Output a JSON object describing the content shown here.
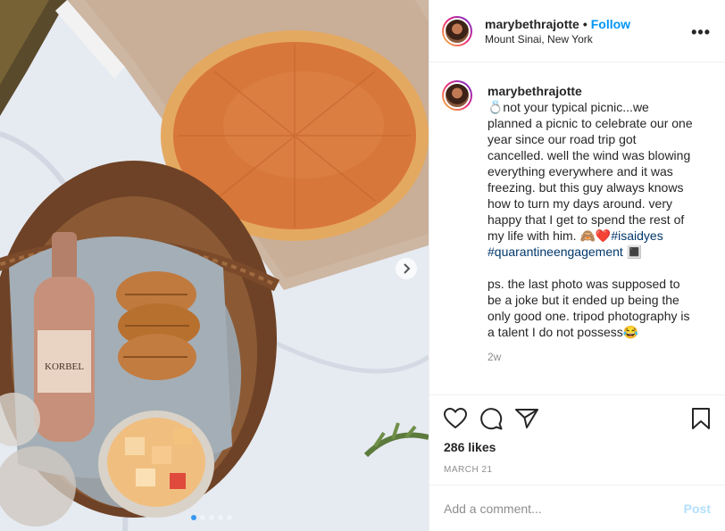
{
  "post": {
    "username": "marybethrajotte",
    "follow_label": "Follow",
    "separator": "•",
    "location": "Mount Sinai, New York",
    "more_label": "•••",
    "caption_lines": [
      "💍not your typical picnic...we",
      "planned a picnic to celebrate our one",
      "year since our road trip got",
      "cancelled. well the wind was blowing",
      "everything everywhere and it was",
      "freezing. but this guy always knows",
      "how to turn my days around. very",
      "happy that I get to spend the rest of",
      "my life with him. 🙈❤️"
    ],
    "hashtag1": "#isaidyes",
    "hashtag2": "#quarantineengagement",
    "hashtag2_suffix": " 🔳",
    "caption_ps_lines": [
      "ps. the last photo was supposed to",
      "be a joke but it ended up being the",
      "only good one. tripod photography is",
      "a talent I do not possess😂"
    ],
    "time_ago": "2w",
    "likes": "286 likes",
    "date": "MARCH 21",
    "comment_placeholder": "Add a comment...",
    "post_button": "Post",
    "photo_dots": 5,
    "photo_active_dot": 1
  },
  "colors": {
    "accent": "#0095f6",
    "post_disabled": "#b2dffc",
    "hashtag": "#00376b"
  },
  "image": {
    "bottle_label": "KORBEL"
  }
}
